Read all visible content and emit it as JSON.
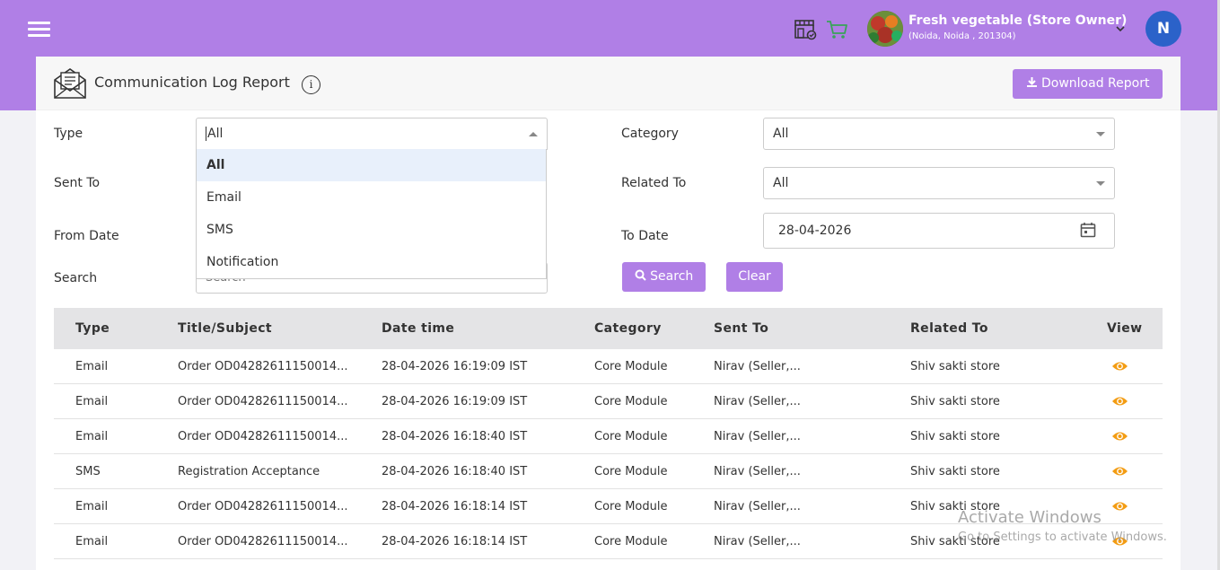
{
  "header": {
    "store_name": "Fresh vegetable (Store Owner)",
    "store_address": "(Noida, Noida , 201304)",
    "user_initial": "N",
    "icons": [
      "menu-icon",
      "store-icon",
      "cart-icon",
      "chevron-down-icon"
    ],
    "accent_color": "#b07fe6"
  },
  "page": {
    "title": "Communication Log Report",
    "info_symbol": "i",
    "download_label": "Download Report"
  },
  "filters": {
    "type_label": "Type",
    "type_value": "All",
    "type_options": [
      "All",
      "Email",
      "SMS",
      "Notification"
    ],
    "category_label": "Category",
    "category_value": "All",
    "sent_to_label": "Sent To",
    "related_to_label": "Related To",
    "related_to_value": "All",
    "from_date_label": "From Date",
    "to_date_label": "To Date",
    "to_date_value": "28-04-2026",
    "search_label": "Search",
    "search_placeholder": "Search",
    "search_button": "Search",
    "clear_button": "Clear"
  },
  "table": {
    "columns": [
      "Type",
      "Title/Subject",
      "Date time",
      "Category",
      "Sent To",
      "Related To",
      "View"
    ],
    "rows": [
      {
        "type": "Email",
        "title": "Order OD04282611150014...",
        "datetime": "28-04-2026 16:19:09 IST",
        "category": "Core Module",
        "sent_to": "Nirav (Seller,...",
        "related_to": "Shiv sakti store"
      },
      {
        "type": "Email",
        "title": "Order OD04282611150014...",
        "datetime": "28-04-2026 16:19:09 IST",
        "category": "Core Module",
        "sent_to": "Nirav (Seller,...",
        "related_to": "Shiv sakti store"
      },
      {
        "type": "Email",
        "title": "Order OD04282611150014...",
        "datetime": "28-04-2026 16:18:40 IST",
        "category": "Core Module",
        "sent_to": "Nirav (Seller,...",
        "related_to": "Shiv sakti store"
      },
      {
        "type": "SMS",
        "title": "Registration Acceptance",
        "datetime": "28-04-2026 16:18:40 IST",
        "category": "Core Module",
        "sent_to": "Nirav (Seller,...",
        "related_to": "Shiv sakti store"
      },
      {
        "type": "Email",
        "title": "Order OD04282611150014...",
        "datetime": "28-04-2026 16:18:14 IST",
        "category": "Core Module",
        "sent_to": "Nirav (Seller,...",
        "related_to": "Shiv sakti store"
      },
      {
        "type": "Email",
        "title": "Order OD04282611150014...",
        "datetime": "28-04-2026 16:18:14 IST",
        "category": "Core Module",
        "sent_to": "Nirav (Seller,...",
        "related_to": "Shiv sakti store"
      }
    ]
  },
  "watermark": {
    "line1": "Activate Windows",
    "line2": "Go to Settings to activate Windows."
  }
}
